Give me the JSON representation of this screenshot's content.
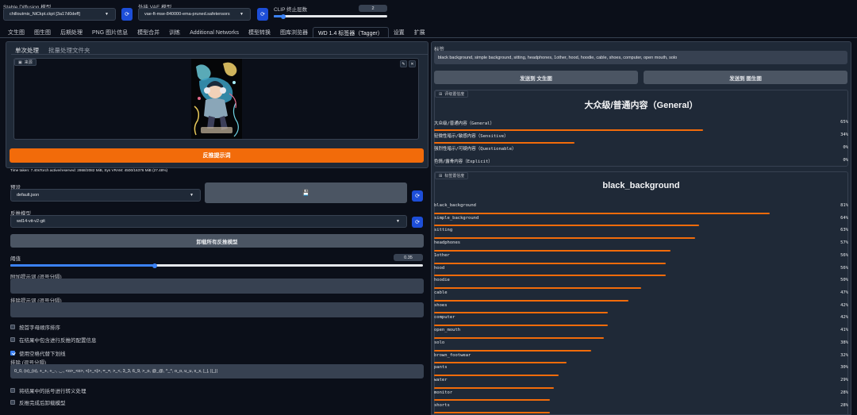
{
  "header": {
    "sd_model_label": "Stable Diffusion 模型",
    "sd_model_value": "chilloutmix_NiCkpt.ckpt [3a17d0deff]",
    "vae_label": "外挂 VAE 模型",
    "vae_value": "vae-ft-mse-840000-ema-pruned.safetensors",
    "clip_label": "CLIP 终止层数",
    "clip_value": "2",
    "clip_fraction": 0.083
  },
  "tabs": [
    {
      "label": "文生图",
      "active": false
    },
    {
      "label": "图生图",
      "active": false
    },
    {
      "label": "后期处理",
      "active": false
    },
    {
      "label": "PNG 图片信息",
      "active": false
    },
    {
      "label": "模型合并",
      "active": false
    },
    {
      "label": "训练",
      "active": false
    },
    {
      "label": "Additional Networks",
      "active": false
    },
    {
      "label": "模型转换",
      "active": false
    },
    {
      "label": "图库浏览器",
      "active": false
    },
    {
      "label": "WD 1.4 标签器（Tagger）",
      "active": true
    },
    {
      "label": "设置",
      "active": false
    },
    {
      "label": "扩展",
      "active": false
    }
  ],
  "left": {
    "subtabs": [
      "单次处理",
      "批量处理文件夹"
    ],
    "source_label": "来源",
    "interrogate_button": "反推提示词",
    "time_info": "Time taken: 7.40sTorch active/reserved: 2868/2082 MiB, Sys VRAM: 4500/16376 MiB (27.48%)",
    "preset_label": "预设",
    "preset_value": "default.json",
    "save_icon_glyph": "💾",
    "interrogator_label": "反推模型",
    "interrogator_value": "wd14-vit-v2-git",
    "unload_button": "卸载所有反推模型",
    "threshold_label": "阈值",
    "threshold_value": "0.35",
    "threshold_fraction": 0.35,
    "additional_tags_label": "附加提示词 (逗号分隔)",
    "exclude_tags_label": "排除提示词 (逗号分隔)",
    "checkboxes": [
      {
        "label": "按首字母顺序排序",
        "checked": false
      },
      {
        "label": "在结果中包含进行反推的配置信息",
        "checked": false
      },
      {
        "label": "使用空格代替下划线",
        "checked": true
      }
    ],
    "exclude_label": "排除 (逗号分隔)",
    "exclude_value": "0_0, (o)_(o), +_+, +_-, ._., <o>_<o>, <|>_<|>, =_=, >_<, 3_3, 6_9, >_o, @_@, ^_^, o_o, u_u, x_x, |_|, ||_||",
    "checkboxes2": [
      {
        "label": "将结果中的括号进行转义处理",
        "checked": false
      },
      {
        "label": "反推完成后卸载模型",
        "checked": false
      }
    ]
  },
  "right": {
    "tags_label": "标签",
    "tags_value": "black background, simple background, sitting, headphones, 1other, hood, hoodie, cable, shoes, computer, open mouth, solo",
    "send_txt2img": "发送到 文生图",
    "send_img2img": "发送到 图生图",
    "rating_label": "评级置信度",
    "rating_title": "大众级/普通内容（General）",
    "ratings": [
      {
        "name": "大众级/普通内容（General）",
        "value": 65
      },
      {
        "name": "轻微性暗示/敏感内容（Sensitive）",
        "value": 34
      },
      {
        "name": "强烈性暗示/可疑内容（Questionable）",
        "value": 0
      },
      {
        "name": "色情/露骨内容（Explicit）",
        "value": 0
      }
    ],
    "tags_conf_label": "标签置信度",
    "tags_title": "black_background",
    "tags": [
      {
        "name": "black_background",
        "value": 81
      },
      {
        "name": "simple_background",
        "value": 64
      },
      {
        "name": "sitting",
        "value": 63
      },
      {
        "name": "headphones",
        "value": 57
      },
      {
        "name": "1other",
        "value": 56
      },
      {
        "name": "hood",
        "value": 56
      },
      {
        "name": "hoodie",
        "value": 50
      },
      {
        "name": "cable",
        "value": 47
      },
      {
        "name": "shoes",
        "value": 42
      },
      {
        "name": "computer",
        "value": 42
      },
      {
        "name": "open_mouth",
        "value": 41
      },
      {
        "name": "solo",
        "value": 38
      },
      {
        "name": "brown_footwear",
        "value": 32
      },
      {
        "name": "pants",
        "value": 30
      },
      {
        "name": "water",
        "value": 29
      },
      {
        "name": "monitor",
        "value": 28
      },
      {
        "name": "shorts",
        "value": 28
      },
      {
        "name": "",
        "value": 27
      }
    ]
  },
  "colors": {
    "accent": "#f26b0a",
    "blue": "#3b82f6",
    "bg": "#0b0f19",
    "panel": "#1f2937"
  },
  "icons": [
    "image-icon",
    "edit-icon",
    "close-icon",
    "refresh-icon",
    "save-icon",
    "chevron-down-icon",
    "label-icon"
  ]
}
